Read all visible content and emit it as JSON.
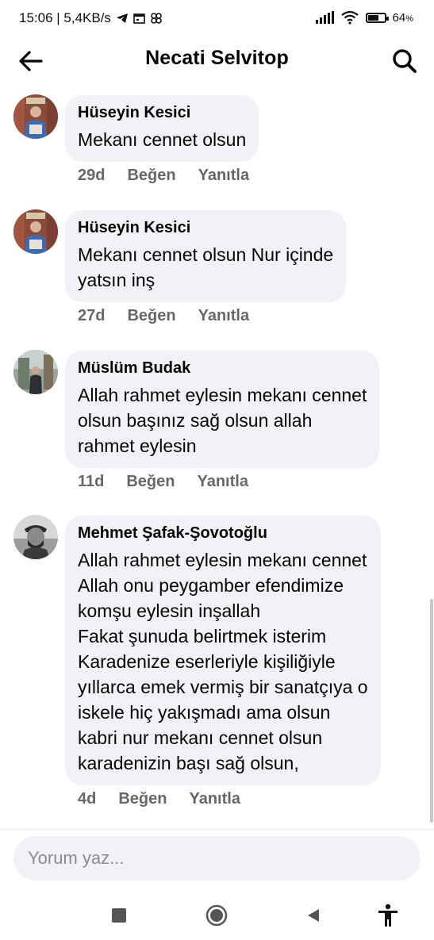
{
  "status_bar": {
    "time_speed": "15:06 | 5,4KB/s",
    "battery_percent": "64",
    "battery_unit": "%",
    "battery_level": 0.64
  },
  "header": {
    "title": "Necati Selvitop"
  },
  "comments": [
    {
      "author": "Hüseyin Kesici",
      "text": "Mekanı cennet olsun",
      "age": "29d",
      "like_label": "Beğen",
      "reply_label": "Yanıtla"
    },
    {
      "author": "Hüseyin Kesici",
      "text": "Mekanı cennet olsun Nur içinde\nyatsın inş",
      "age": "27d",
      "like_label": "Beğen",
      "reply_label": "Yanıtla"
    },
    {
      "author": "Müslüm Budak",
      "text": "Allah rahmet eylesin mekanı cennet\nolsun başınız sağ olsun allah\nrahmet eylesin",
      "age": "11d",
      "like_label": "Beğen",
      "reply_label": "Yanıtla"
    },
    {
      "author": "Mehmet Şafak-Şovotoğlu",
      "text": "Allah rahmet eylesin mekanı cennet\nAllah onu peygamber efendimize\nkomşu eylesin inşallah\nFakat şunuda belirtmek isterim\nKaradenize eserleriyle kişiliğiyle\nyıllarca emek vermiş bir sanatçıya o\niskele hiç yakışmadı ama olsun\nkabri nur mekanı cennet olsun\nkaradenizin başı sağ olsun,",
      "age": "4d",
      "like_label": "Beğen",
      "reply_label": "Yanıtla"
    }
  ],
  "composer": {
    "placeholder": "Yorum yaz..."
  },
  "icons": {
    "back": "arrow-left-icon",
    "search": "search-icon",
    "nav_recents": "square-icon",
    "nav_home": "circle-icon",
    "nav_back": "triangle-back-icon",
    "nav_accessibility": "accessibility-icon"
  },
  "colors": {
    "bubble": "#f0f2f5",
    "meta_text": "#65676b",
    "text": "#050505"
  }
}
